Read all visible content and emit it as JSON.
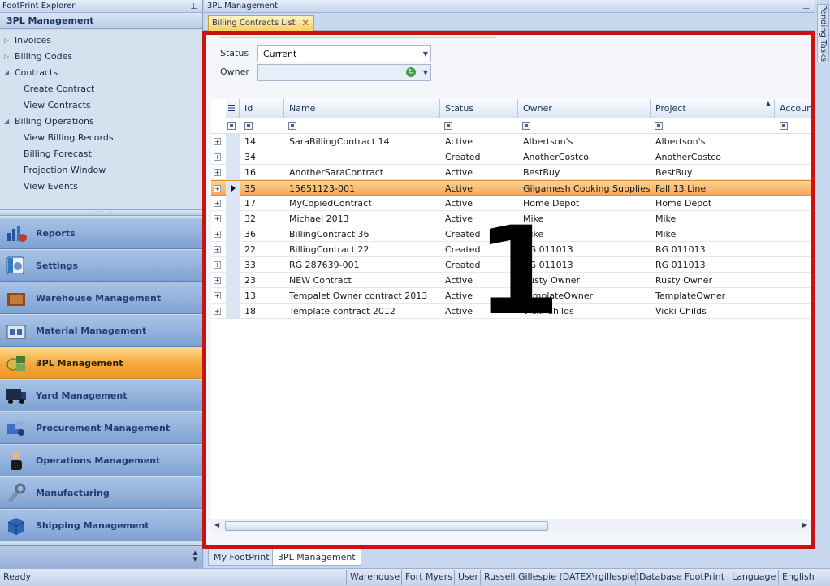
{
  "explorer": {
    "title": "FootPrint Explorer",
    "header": "3PL Management",
    "tree": [
      {
        "label": "Invoices",
        "level": 0,
        "state": "collapsed"
      },
      {
        "label": "Billing Codes",
        "level": 0,
        "state": "collapsed"
      },
      {
        "label": "Contracts",
        "level": 0,
        "state": "expanded"
      },
      {
        "label": "Create Contract",
        "level": 1
      },
      {
        "label": "View Contracts",
        "level": 1
      },
      {
        "label": "Billing Operations",
        "level": 0,
        "state": "expanded"
      },
      {
        "label": "View Billing Records",
        "level": 1
      },
      {
        "label": "Billing Forecast",
        "level": 1
      },
      {
        "label": "Projection Window",
        "level": 1
      },
      {
        "label": "View Events",
        "level": 1
      }
    ],
    "nav": [
      {
        "label": "Reports",
        "icon": "reports-icon"
      },
      {
        "label": "Settings",
        "icon": "settings-icon"
      },
      {
        "label": "Warehouse Management",
        "icon": "warehouse-icon"
      },
      {
        "label": "Material Management",
        "icon": "material-icon"
      },
      {
        "label": "3PL Management",
        "icon": "3pl-icon",
        "active": true
      },
      {
        "label": "Yard Management",
        "icon": "yard-icon"
      },
      {
        "label": "Procurement Management",
        "icon": "procurement-icon"
      },
      {
        "label": "Operations Management",
        "icon": "operations-icon"
      },
      {
        "label": "Manufacturing",
        "icon": "manufacturing-icon"
      },
      {
        "label": "Shipping Management",
        "icon": "shipping-icon"
      }
    ]
  },
  "document": {
    "title": "3PL Management",
    "tab": "Billing Contracts List",
    "pending_tasks": "Pending Tasks"
  },
  "filters": {
    "status_label": "Status",
    "status_value": "Current",
    "owner_label": "Owner",
    "owner_value": ""
  },
  "grid": {
    "columns": [
      "Id",
      "Name",
      "Status",
      "Owner",
      "Project",
      "Account"
    ],
    "rows": [
      {
        "id": "14",
        "name": "SaraBillingContract 14",
        "status": "Active",
        "owner": "Albertson's",
        "project": "Albertson's"
      },
      {
        "id": "34",
        "name": "",
        "status": "Created",
        "owner": "AnotherCostco",
        "project": "AnotherCostco"
      },
      {
        "id": "16",
        "name": "AnotherSaraContract",
        "status": "Active",
        "owner": "BestBuy",
        "project": "BestBuy"
      },
      {
        "id": "35",
        "name": "15651123-001",
        "status": "Active",
        "owner": "Gilgamesh Cooking Supplies",
        "project": "Fall 13 Line",
        "selected": true
      },
      {
        "id": "17",
        "name": "MyCopiedContract",
        "status": "Active",
        "owner": "Home Depot",
        "project": "Home Depot"
      },
      {
        "id": "32",
        "name": "Michael 2013",
        "status": "Active",
        "owner": "Mike",
        "project": "Mike"
      },
      {
        "id": "36",
        "name": "BillingContract 36",
        "status": "Created",
        "owner": "Mike",
        "project": "Mike"
      },
      {
        "id": "22",
        "name": "BillingContract 22",
        "status": "Created",
        "owner": "RG 011013",
        "project": "RG 011013"
      },
      {
        "id": "33",
        "name": "RG 287639-001",
        "status": "Created",
        "owner": "RG 011013",
        "project": "RG 011013"
      },
      {
        "id": "23",
        "name": "NEW Contract",
        "status": "Active",
        "owner": "Rusty Owner",
        "project": "Rusty Owner"
      },
      {
        "id": "13",
        "name": "Tempalet Owner contract 2013",
        "status": "Active",
        "owner": "TemplateOwner",
        "project": "TemplateOwner"
      },
      {
        "id": "18",
        "name": "Template contract 2012",
        "status": "Active",
        "owner": "Vicki Childs",
        "project": "Vicki Childs"
      }
    ]
  },
  "callout": {
    "number": "1",
    "color": "#cc1111"
  },
  "bottom_tabs": [
    "My FootPrint",
    "3PL Management"
  ],
  "statusbar": {
    "status": "Ready",
    "fields": [
      "Warehouse",
      "Fort Myers",
      "User",
      "Russell Gillespie (DATEX\\rgillespie)",
      "Database",
      "FootPrint",
      "Language",
      "English"
    ]
  }
}
